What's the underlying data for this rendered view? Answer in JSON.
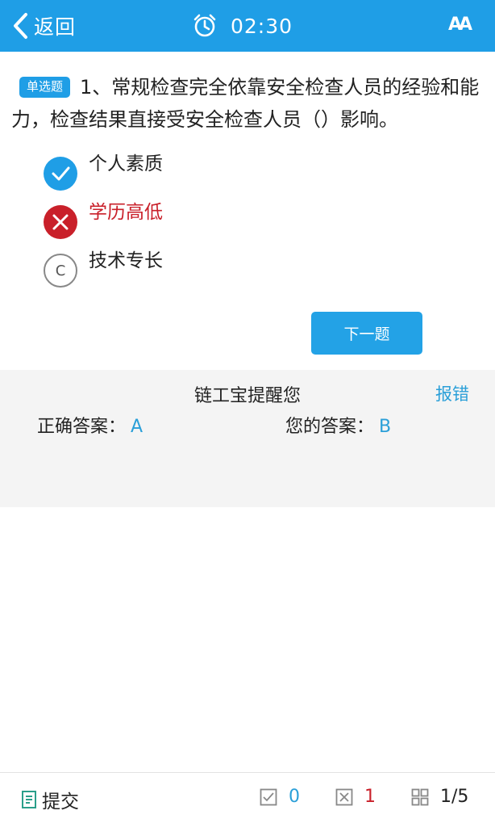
{
  "header": {
    "back_label": "返回",
    "timer": "02:30",
    "font_toggle_label": "AA"
  },
  "question": {
    "type_tag": "单选题",
    "text": "1、常规检查完全依靠安全检查人员的经验和能力，检查结果直接受安全检查人员（）影响。",
    "options": [
      {
        "text": "个人素质",
        "state": "correct"
      },
      {
        "text": "学历高低",
        "state": "wrong"
      },
      {
        "letter": "C",
        "text": "技术专长",
        "state": "plain"
      }
    ]
  },
  "next_button_label": "下一题",
  "reminder": {
    "title": "链工宝提醒您",
    "report_label": "报错",
    "correct_label": "正确答案：",
    "correct_value": "A",
    "yours_label": "您的答案：",
    "yours_value": "B"
  },
  "footer": {
    "submit_label": "提交",
    "correct_count": "0",
    "wrong_count": "1",
    "progress": "1/5"
  },
  "colors": {
    "accent": "#1f9ee6",
    "wrong": "#c9202a",
    "link": "#2a9fd8"
  }
}
